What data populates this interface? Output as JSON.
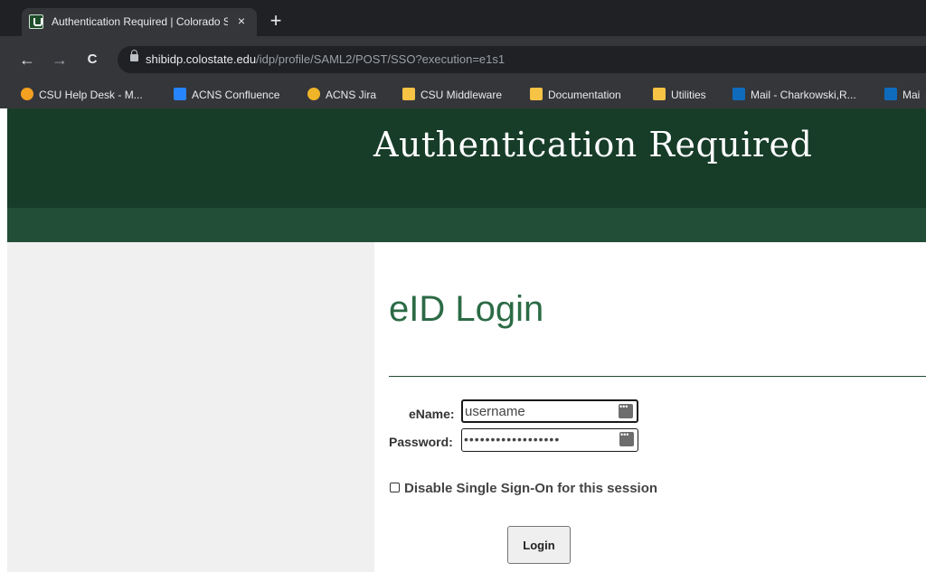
{
  "browser": {
    "tab_title": "Authentication Required | Colorado State University",
    "tab_close": "×",
    "new_tab": "+",
    "back": "←",
    "forward": "→",
    "reload": "C",
    "url_host": "shibidp.colostate.edu",
    "url_path": "/idp/profile/SAML2/POST/SSO?execution=e1s1",
    "bookmarks": [
      {
        "label": "CSU Help Desk - M...",
        "icon": "lifebuoy-icon",
        "color": "#f4a020"
      },
      {
        "label": "ACNS Confluence",
        "icon": "confluence-icon",
        "color": "#2684ff"
      },
      {
        "label": "ACNS Jira",
        "icon": "jira-icon",
        "color": "#f0b429"
      },
      {
        "label": "CSU Middleware",
        "icon": "folder-icon",
        "color": "#f6c344"
      },
      {
        "label": "Documentation",
        "icon": "folder-icon",
        "color": "#f6c344"
      },
      {
        "label": "Utilities",
        "icon": "folder-icon",
        "color": "#f6c344"
      },
      {
        "label": "Mail - Charkowski,R...",
        "icon": "outlook-icon",
        "color": "#0f6cbd"
      },
      {
        "label": "Mai",
        "icon": "outlook-icon",
        "color": "#0f6cbd"
      }
    ]
  },
  "page": {
    "banner_title": "Authentication Required",
    "heading": "eID Login",
    "ename_label": "eName:",
    "ename_value": "username",
    "password_label": "Password:",
    "password_value": "••••••••••••••••••",
    "sso_checkbox_label": "Disable Single Sign-On for this session",
    "login_button": "Login"
  },
  "colors": {
    "banner": "#173d29",
    "subbar": "#224e37",
    "heading": "#2b6b45"
  }
}
